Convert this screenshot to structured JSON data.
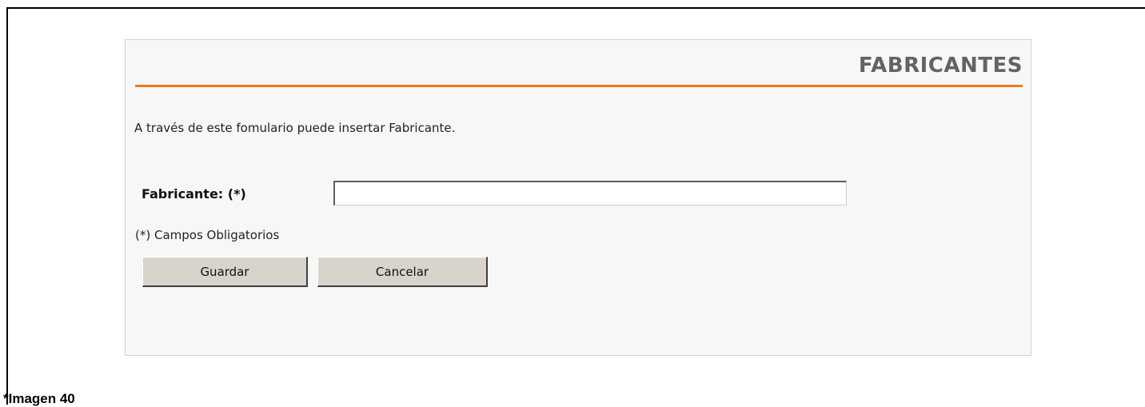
{
  "form": {
    "title": "FABRICANTES",
    "intro": "A través de este fomulario puede insertar Fabricante.",
    "field_label": "Fabricante: (*)",
    "field_value": "",
    "required_note": "(*) Campos Obligatorios",
    "save_label": "Guardar",
    "cancel_label": "Cancelar"
  },
  "caption": "*Imagen 40",
  "colors": {
    "accent_rule": "#f07a1e",
    "title_text": "#636363",
    "panel_bg": "#f7f7f7",
    "button_bg": "#d8d4cc"
  }
}
